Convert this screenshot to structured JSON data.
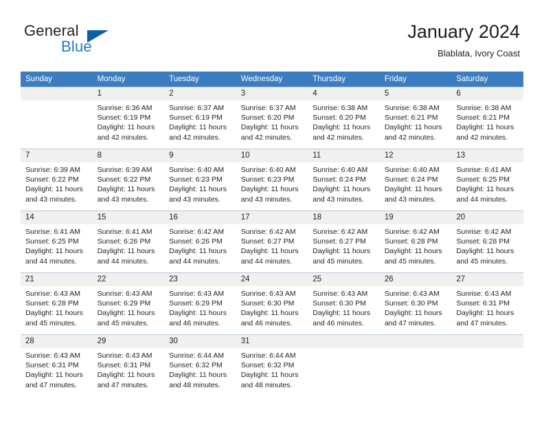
{
  "brand": {
    "name_part1": "General",
    "name_part2": "Blue",
    "flag_icon": "blue-triangle-flag-icon",
    "accent_color": "#2079c7",
    "header_color": "#3b7dc0"
  },
  "header": {
    "title": "January 2024",
    "subtitle": "Blablata, Ivory Coast"
  },
  "weekdays": [
    "Sunday",
    "Monday",
    "Tuesday",
    "Wednesday",
    "Thursday",
    "Friday",
    "Saturday"
  ],
  "labels": {
    "sunrise_prefix": "Sunrise: ",
    "sunset_prefix": "Sunset: ",
    "daylight_prefix": "Daylight: "
  },
  "weeks": [
    [
      {
        "day": "",
        "sunrise": "",
        "sunset": "",
        "daylight_line1": "",
        "daylight_line2": ""
      },
      {
        "day": "1",
        "sunrise": "Sunrise: 6:36 AM",
        "sunset": "Sunset: 6:19 PM",
        "daylight_line1": "Daylight: 11 hours",
        "daylight_line2": "and 42 minutes."
      },
      {
        "day": "2",
        "sunrise": "Sunrise: 6:37 AM",
        "sunset": "Sunset: 6:19 PM",
        "daylight_line1": "Daylight: 11 hours",
        "daylight_line2": "and 42 minutes."
      },
      {
        "day": "3",
        "sunrise": "Sunrise: 6:37 AM",
        "sunset": "Sunset: 6:20 PM",
        "daylight_line1": "Daylight: 11 hours",
        "daylight_line2": "and 42 minutes."
      },
      {
        "day": "4",
        "sunrise": "Sunrise: 6:38 AM",
        "sunset": "Sunset: 6:20 PM",
        "daylight_line1": "Daylight: 11 hours",
        "daylight_line2": "and 42 minutes."
      },
      {
        "day": "5",
        "sunrise": "Sunrise: 6:38 AM",
        "sunset": "Sunset: 6:21 PM",
        "daylight_line1": "Daylight: 11 hours",
        "daylight_line2": "and 42 minutes."
      },
      {
        "day": "6",
        "sunrise": "Sunrise: 6:38 AM",
        "sunset": "Sunset: 6:21 PM",
        "daylight_line1": "Daylight: 11 hours",
        "daylight_line2": "and 42 minutes."
      }
    ],
    [
      {
        "day": "7",
        "sunrise": "Sunrise: 6:39 AM",
        "sunset": "Sunset: 6:22 PM",
        "daylight_line1": "Daylight: 11 hours",
        "daylight_line2": "and 43 minutes."
      },
      {
        "day": "8",
        "sunrise": "Sunrise: 6:39 AM",
        "sunset": "Sunset: 6:22 PM",
        "daylight_line1": "Daylight: 11 hours",
        "daylight_line2": "and 43 minutes."
      },
      {
        "day": "9",
        "sunrise": "Sunrise: 6:40 AM",
        "sunset": "Sunset: 6:23 PM",
        "daylight_line1": "Daylight: 11 hours",
        "daylight_line2": "and 43 minutes."
      },
      {
        "day": "10",
        "sunrise": "Sunrise: 6:40 AM",
        "sunset": "Sunset: 6:23 PM",
        "daylight_line1": "Daylight: 11 hours",
        "daylight_line2": "and 43 minutes."
      },
      {
        "day": "11",
        "sunrise": "Sunrise: 6:40 AM",
        "sunset": "Sunset: 6:24 PM",
        "daylight_line1": "Daylight: 11 hours",
        "daylight_line2": "and 43 minutes."
      },
      {
        "day": "12",
        "sunrise": "Sunrise: 6:40 AM",
        "sunset": "Sunset: 6:24 PM",
        "daylight_line1": "Daylight: 11 hours",
        "daylight_line2": "and 43 minutes."
      },
      {
        "day": "13",
        "sunrise": "Sunrise: 6:41 AM",
        "sunset": "Sunset: 6:25 PM",
        "daylight_line1": "Daylight: 11 hours",
        "daylight_line2": "and 44 minutes."
      }
    ],
    [
      {
        "day": "14",
        "sunrise": "Sunrise: 6:41 AM",
        "sunset": "Sunset: 6:25 PM",
        "daylight_line1": "Daylight: 11 hours",
        "daylight_line2": "and 44 minutes."
      },
      {
        "day": "15",
        "sunrise": "Sunrise: 6:41 AM",
        "sunset": "Sunset: 6:26 PM",
        "daylight_line1": "Daylight: 11 hours",
        "daylight_line2": "and 44 minutes."
      },
      {
        "day": "16",
        "sunrise": "Sunrise: 6:42 AM",
        "sunset": "Sunset: 6:26 PM",
        "daylight_line1": "Daylight: 11 hours",
        "daylight_line2": "and 44 minutes."
      },
      {
        "day": "17",
        "sunrise": "Sunrise: 6:42 AM",
        "sunset": "Sunset: 6:27 PM",
        "daylight_line1": "Daylight: 11 hours",
        "daylight_line2": "and 44 minutes."
      },
      {
        "day": "18",
        "sunrise": "Sunrise: 6:42 AM",
        "sunset": "Sunset: 6:27 PM",
        "daylight_line1": "Daylight: 11 hours",
        "daylight_line2": "and 45 minutes."
      },
      {
        "day": "19",
        "sunrise": "Sunrise: 6:42 AM",
        "sunset": "Sunset: 6:28 PM",
        "daylight_line1": "Daylight: 11 hours",
        "daylight_line2": "and 45 minutes."
      },
      {
        "day": "20",
        "sunrise": "Sunrise: 6:42 AM",
        "sunset": "Sunset: 6:28 PM",
        "daylight_line1": "Daylight: 11 hours",
        "daylight_line2": "and 45 minutes."
      }
    ],
    [
      {
        "day": "21",
        "sunrise": "Sunrise: 6:43 AM",
        "sunset": "Sunset: 6:28 PM",
        "daylight_line1": "Daylight: 11 hours",
        "daylight_line2": "and 45 minutes."
      },
      {
        "day": "22",
        "sunrise": "Sunrise: 6:43 AM",
        "sunset": "Sunset: 6:29 PM",
        "daylight_line1": "Daylight: 11 hours",
        "daylight_line2": "and 45 minutes."
      },
      {
        "day": "23",
        "sunrise": "Sunrise: 6:43 AM",
        "sunset": "Sunset: 6:29 PM",
        "daylight_line1": "Daylight: 11 hours",
        "daylight_line2": "and 46 minutes."
      },
      {
        "day": "24",
        "sunrise": "Sunrise: 6:43 AM",
        "sunset": "Sunset: 6:30 PM",
        "daylight_line1": "Daylight: 11 hours",
        "daylight_line2": "and 46 minutes."
      },
      {
        "day": "25",
        "sunrise": "Sunrise: 6:43 AM",
        "sunset": "Sunset: 6:30 PM",
        "daylight_line1": "Daylight: 11 hours",
        "daylight_line2": "and 46 minutes."
      },
      {
        "day": "26",
        "sunrise": "Sunrise: 6:43 AM",
        "sunset": "Sunset: 6:30 PM",
        "daylight_line1": "Daylight: 11 hours",
        "daylight_line2": "and 47 minutes."
      },
      {
        "day": "27",
        "sunrise": "Sunrise: 6:43 AM",
        "sunset": "Sunset: 6:31 PM",
        "daylight_line1": "Daylight: 11 hours",
        "daylight_line2": "and 47 minutes."
      }
    ],
    [
      {
        "day": "28",
        "sunrise": "Sunrise: 6:43 AM",
        "sunset": "Sunset: 6:31 PM",
        "daylight_line1": "Daylight: 11 hours",
        "daylight_line2": "and 47 minutes."
      },
      {
        "day": "29",
        "sunrise": "Sunrise: 6:43 AM",
        "sunset": "Sunset: 6:31 PM",
        "daylight_line1": "Daylight: 11 hours",
        "daylight_line2": "and 47 minutes."
      },
      {
        "day": "30",
        "sunrise": "Sunrise: 6:44 AM",
        "sunset": "Sunset: 6:32 PM",
        "daylight_line1": "Daylight: 11 hours",
        "daylight_line2": "and 48 minutes."
      },
      {
        "day": "31",
        "sunrise": "Sunrise: 6:44 AM",
        "sunset": "Sunset: 6:32 PM",
        "daylight_line1": "Daylight: 11 hours",
        "daylight_line2": "and 48 minutes."
      },
      {
        "day": "",
        "sunrise": "",
        "sunset": "",
        "daylight_line1": "",
        "daylight_line2": ""
      },
      {
        "day": "",
        "sunrise": "",
        "sunset": "",
        "daylight_line1": "",
        "daylight_line2": ""
      },
      {
        "day": "",
        "sunrise": "",
        "sunset": "",
        "daylight_line1": "",
        "daylight_line2": ""
      }
    ]
  ]
}
